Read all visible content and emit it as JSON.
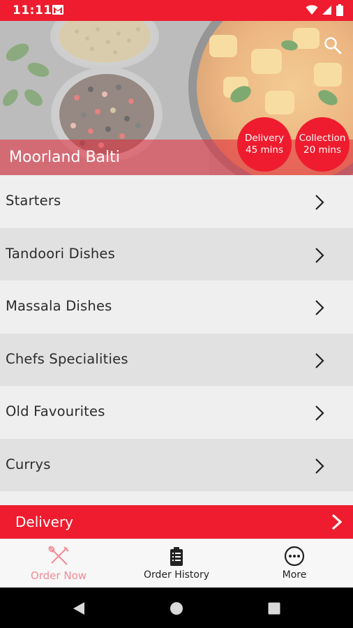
{
  "status_bar": {
    "time": "11:11",
    "background": "#ee1c2e",
    "icons": [
      "gmail-icon",
      "wifi-icon",
      "signal-icon",
      "battery-icon"
    ]
  },
  "header": {
    "restaurant_name": "Moorland Balti",
    "search_icon": "search-icon",
    "badges": [
      {
        "line1": "Delivery",
        "line2": "45 mins"
      },
      {
        "line1": "Collection",
        "line2": "20 mins"
      }
    ]
  },
  "menu": {
    "categories": [
      {
        "label": "Starters"
      },
      {
        "label": "Tandoori Dishes"
      },
      {
        "label": "Massala Dishes"
      },
      {
        "label": "Chefs Specialities"
      },
      {
        "label": "Old Favourites"
      },
      {
        "label": "Currys"
      }
    ],
    "row_icon": "chevron-right-icon"
  },
  "order_type": {
    "label": "Delivery",
    "icon": "chevron-right-icon"
  },
  "bottom_nav": {
    "items": [
      {
        "label": "Order Now",
        "icon": "fork-knife-icon",
        "active": true
      },
      {
        "label": "Order History",
        "icon": "clipboard-icon",
        "active": false
      },
      {
        "label": "More",
        "icon": "more-icon",
        "active": false
      }
    ],
    "active_color": "#f28a94"
  },
  "system_nav": {
    "icons": [
      "back-icon",
      "home-icon",
      "recents-icon"
    ]
  },
  "colors": {
    "accent": "#ee1c2e",
    "row_light": "#efefef",
    "row_dark": "#e1e1e1"
  }
}
